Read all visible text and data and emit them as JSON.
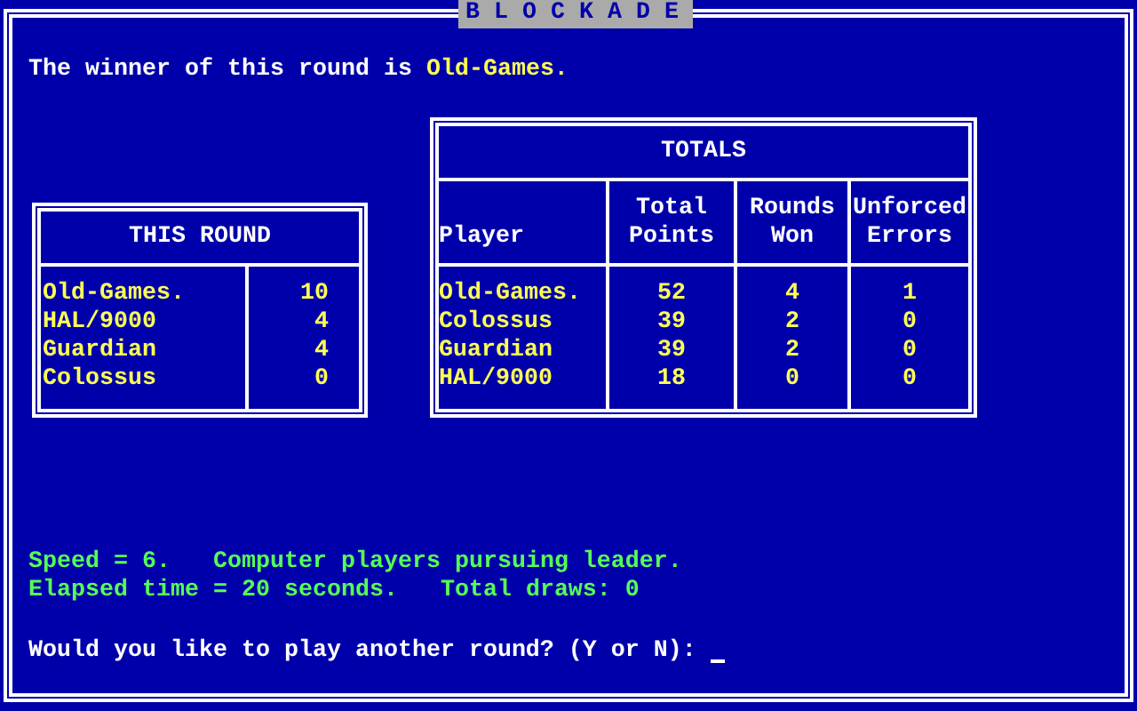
{
  "title": "BLOCKADE",
  "winner": {
    "prefix": "The winner of this round is",
    "name": "Old-Games."
  },
  "this_round": {
    "title": "THIS ROUND",
    "rows": [
      {
        "player": "Old-Games.",
        "points": "10"
      },
      {
        "player": "HAL/9000",
        "points": "4"
      },
      {
        "player": "Guardian",
        "points": "4"
      },
      {
        "player": "Colossus",
        "points": "0"
      }
    ]
  },
  "totals": {
    "title": "TOTALS",
    "columns": [
      "Player",
      "Total Points",
      "Rounds Won",
      "Unforced Errors"
    ],
    "rows": [
      {
        "player": "Old-Games.",
        "points": "52",
        "rounds": "4",
        "errors": "1"
      },
      {
        "player": "Colossus",
        "points": "39",
        "rounds": "2",
        "errors": "0"
      },
      {
        "player": "Guardian",
        "points": "39",
        "rounds": "2",
        "errors": "0"
      },
      {
        "player": "HAL/9000",
        "points": "18",
        "rounds": "0",
        "errors": "0"
      }
    ]
  },
  "status": [
    [
      "Speed = 6.",
      "Computer players pursuing leader."
    ],
    [
      "Elapsed time = 20 seconds.",
      "Total draws: 0"
    ]
  ],
  "prompt": "Would you like to play another round? (Y or N):"
}
